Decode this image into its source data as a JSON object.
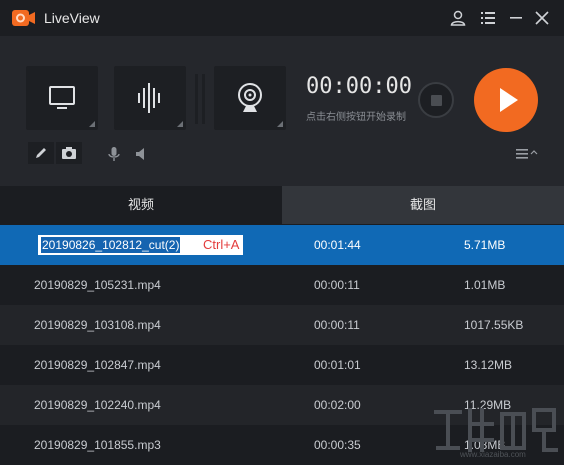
{
  "window": {
    "title": "LiveView"
  },
  "recorder": {
    "timer": "00:00:00",
    "hint": "点击右侧按钮开始录制"
  },
  "tabs": [
    {
      "label": "视频"
    },
    {
      "label": "截图"
    }
  ],
  "rename": {
    "value": "20190826_102812_cut(2)",
    "shortcut": "Ctrl+A"
  },
  "files": [
    {
      "name": "",
      "duration": "00:01:44",
      "size": "5.71MB"
    },
    {
      "name": "20190829_105231.mp4",
      "duration": "00:00:11",
      "size": "1.01MB"
    },
    {
      "name": "20190829_103108.mp4",
      "duration": "00:00:11",
      "size": "1017.55KB"
    },
    {
      "name": "20190829_102847.mp4",
      "duration": "00:01:01",
      "size": "13.12MB"
    },
    {
      "name": "20190829_102240.mp4",
      "duration": "00:02:00",
      "size": "11.29MB"
    },
    {
      "name": "20190829_101855.mp3",
      "duration": "00:00:35",
      "size": "1.08MB"
    }
  ],
  "watermark": {
    "text": "www.xiazaiba.com"
  },
  "colors": {
    "accent": "#f26a21",
    "selection": "#1069b5",
    "shortcut": "#e33b3b"
  }
}
